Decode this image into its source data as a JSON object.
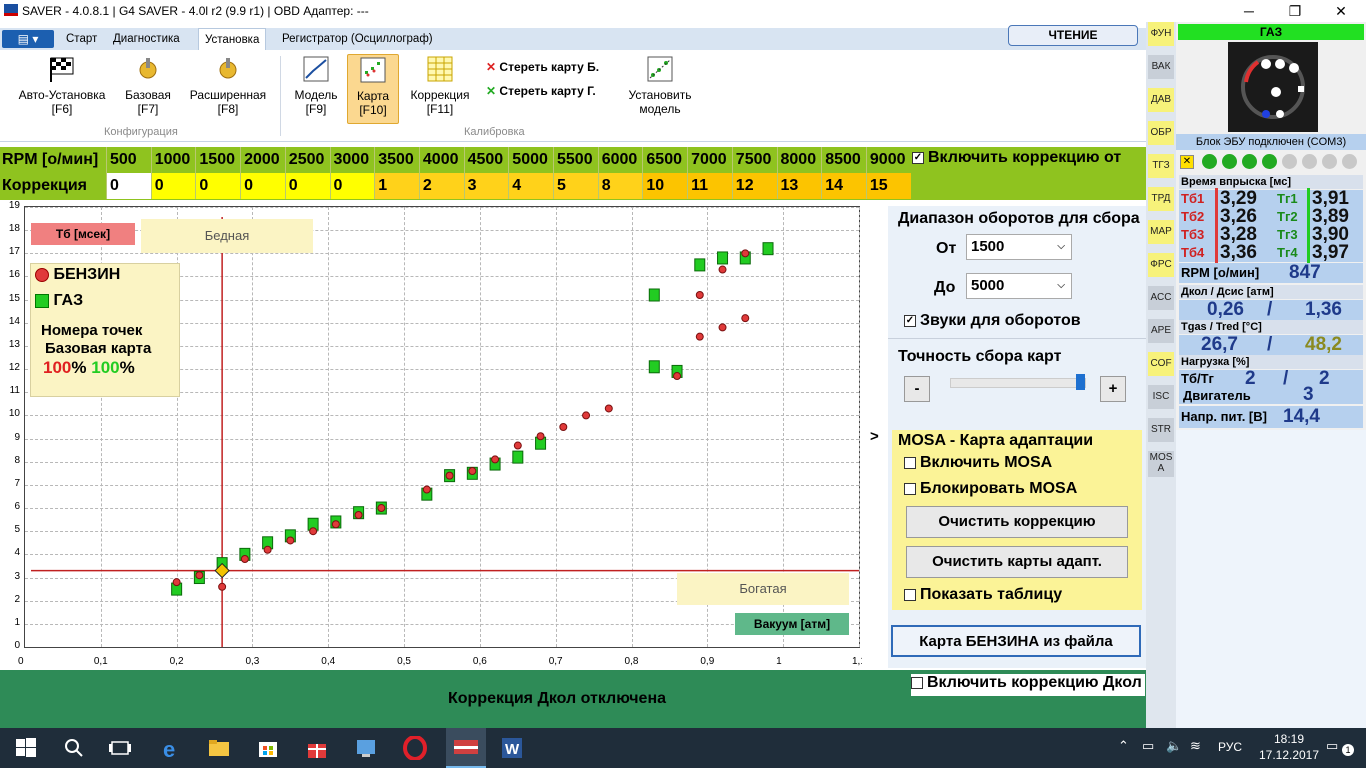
{
  "window": {
    "title": "SAVER - 4.0.8.1 | G4 SAVER - 4.0l r2 (9.9 r1) | OBD Адаптер: ---",
    "min": "─",
    "max": "❐",
    "close": "✕"
  },
  "tabs": [
    "Старт",
    "Диагностика",
    "Установка",
    "Регистратор (Осциллограф)"
  ],
  "read_button": "ЧТЕНИЕ",
  "ribbon": {
    "config": [
      {
        "label": "Авто-Установка",
        "key": "[F6]"
      },
      {
        "label": "Базовая",
        "key": "[F7]"
      },
      {
        "label": "Расширенная",
        "key": "[F8]"
      }
    ],
    "config_group": "Конфигурация",
    "calib": [
      {
        "label": "Модель",
        "key": "[F9]"
      },
      {
        "label": "Карта",
        "key": "[F10]"
      },
      {
        "label": "Коррекция",
        "key": "[F11]"
      }
    ],
    "erase_b": "Стереть карту Б.",
    "erase_g": "Стереть карту Г.",
    "set_model": [
      "Установить",
      "модель"
    ],
    "calib_group": "Калибровка"
  },
  "rpm_table": {
    "rpm_label": "RPM [о/мин]",
    "corr_label": "Коррекция",
    "rpm": [
      "500",
      "1000",
      "1500",
      "2000",
      "2500",
      "3000",
      "3500",
      "4000",
      "4500",
      "5000",
      "5500",
      "6000",
      "6500",
      "7000",
      "7500",
      "8000",
      "8500",
      "9000"
    ],
    "corr": [
      "0",
      "0",
      "0",
      "0",
      "0",
      "0",
      "1",
      "2",
      "3",
      "4",
      "5",
      "8",
      "10",
      "11",
      "12",
      "13",
      "14",
      "15"
    ],
    "enable_corr": "Включить коррекцию от"
  },
  "chart": {
    "tb_label": "Тб [мсек]",
    "lean": "Бедная",
    "rich": "Богатая",
    "vacuum": "Вакуум [атм]",
    "legend": {
      "petrol": "БЕНЗИН",
      "gas": "ГАЗ",
      "points": "Номера точек",
      "base": "Базовая карта",
      "p1": "100",
      "p2": "100",
      "pct": "%"
    },
    "yticks": [
      "0",
      "1",
      "2",
      "3",
      "4",
      "5",
      "6",
      "7",
      "8",
      "9",
      "10",
      "11",
      "12",
      "13",
      "14",
      "15",
      "16",
      "17",
      "18",
      "19"
    ],
    "xticks": [
      "0",
      "0,1",
      "0,2",
      "0,3",
      "0,4",
      "0,5",
      "0,6",
      "0,7",
      "0,8",
      "0,9",
      "1",
      "1,1"
    ]
  },
  "chart_data": {
    "type": "scatter",
    "xlabel": "Вакуум [атм]",
    "ylabel": "Тб [мсек]",
    "xlim": [
      0,
      1.1
    ],
    "ylim": [
      0,
      19
    ],
    "cursor": {
      "x": 0.26,
      "y": 3.3
    },
    "series": [
      {
        "name": "БЕНЗИН",
        "color": "#e03a3a",
        "x": [
          0.2,
          0.23,
          0.26,
          0.29,
          0.32,
          0.35,
          0.38,
          0.41,
          0.44,
          0.47,
          0.53,
          0.56,
          0.59,
          0.62,
          0.65,
          0.68,
          0.71,
          0.74,
          0.77,
          0.86,
          0.89,
          0.89,
          0.92,
          0.92,
          0.95,
          0.95
        ],
        "y": [
          2.8,
          3.1,
          2.6,
          3.8,
          4.2,
          4.6,
          5.0,
          5.3,
          5.7,
          6.0,
          6.8,
          7.4,
          7.6,
          8.1,
          8.7,
          9.1,
          9.5,
          10.0,
          10.3,
          11.7,
          13.4,
          15.2,
          13.8,
          16.3,
          14.2,
          17.0
        ]
      },
      {
        "name": "ГАЗ",
        "color": "#22cc22",
        "x": [
          0.2,
          0.23,
          0.26,
          0.29,
          0.32,
          0.35,
          0.38,
          0.41,
          0.44,
          0.47,
          0.53,
          0.56,
          0.59,
          0.62,
          0.65,
          0.68,
          0.83,
          0.83,
          0.86,
          0.89,
          0.92,
          0.95,
          0.98
        ],
        "y": [
          2.5,
          3.0,
          3.6,
          4.0,
          4.5,
          4.8,
          5.3,
          5.4,
          5.8,
          6.0,
          6.6,
          7.4,
          7.5,
          7.9,
          8.2,
          8.8,
          12.1,
          15.2,
          11.9,
          16.5,
          16.8,
          16.8,
          17.2
        ]
      }
    ]
  },
  "right": {
    "range_title": "Диапазон оборотов для сбора",
    "from": "От",
    "from_val": "1500",
    "to": "До",
    "to_val": "5000",
    "sounds": "Звуки для оборотов",
    "precision": "Точность сбора карт",
    "minus": "-",
    "plus": "+",
    "expand": ">"
  },
  "mosa": {
    "title": "MOSA - Карта адаптации",
    "enable": "Включить MOSA",
    "block": "Блокировать MOSA",
    "clear_corr": "Очистить коррекцию",
    "clear_maps": "Очистить карты адапт.",
    "show_table": "Показать таблицу"
  },
  "petrol_file": "Карта БЕНЗИНА из файла",
  "status": {
    "text": "Коррекция Дкол отключена",
    "enable": "Включить коррекцию Дкол"
  },
  "vtabs": [
    "ФУН",
    "ВАК",
    "ДАВ",
    "ОБР",
    "ТГЗ",
    "ТРД",
    "МАР",
    "ФРС",
    "АСС",
    "АРЕ",
    "COF",
    "ISC",
    "STR",
    "MOS A"
  ],
  "side": {
    "gas": "ГАЗ",
    "ecu": "Блок ЭБУ подключен (COM3)",
    "inj_title": "Время впрыска [мс]",
    "tb": [
      {
        "l": "Тб1",
        "v": "3,29"
      },
      {
        "l": "Тб2",
        "v": "3,26"
      },
      {
        "l": "Тб3",
        "v": "3,28"
      },
      {
        "l": "Тб4",
        "v": "3,36"
      }
    ],
    "tg": [
      {
        "l": "Тг1",
        "v": "3,91"
      },
      {
        "l": "Тг2",
        "v": "3,89"
      },
      {
        "l": "Тг3",
        "v": "3,90"
      },
      {
        "l": "Тг4",
        "v": "3,97"
      }
    ],
    "rpm_label": "RPM [о/мин]",
    "rpm": "847",
    "press_title": "Дкол / Дсис [атм]",
    "p1": "0,26",
    "p2": "1,36",
    "slash": "/",
    "temp_title": "Tgas / Tred [°C]",
    "t1": "26,7",
    "t2": "48,2",
    "load_title": "Нагрузка [%]",
    "tbtg": "Тб/Тг",
    "l1": "2",
    "l2": "2",
    "engine": "Двигатель",
    "eng": "3",
    "volt_label": "Напр. пит. [В]",
    "volt": "14,4"
  },
  "taskbar": {
    "lang": "РУС",
    "time": "18:19",
    "date": "17.12.2017",
    "notif": "1"
  }
}
